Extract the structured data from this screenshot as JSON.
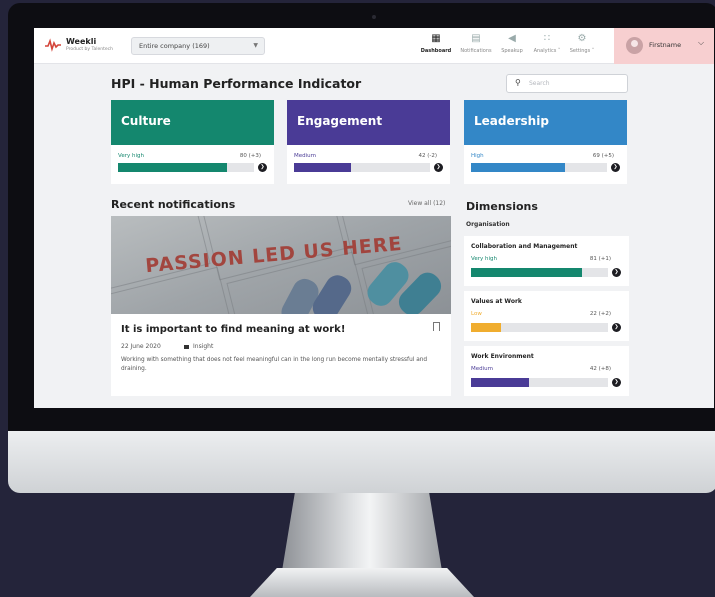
{
  "app": {
    "brand": "Weekli",
    "brand_sub": "Product by Talentech",
    "company_selector": "Entire company (169)"
  },
  "nav": [
    {
      "label": "Dashboard",
      "icon": "grid-icon"
    },
    {
      "label": "Notifications",
      "icon": "message-icon"
    },
    {
      "label": "Speakup",
      "icon": "megaphone-icon"
    },
    {
      "label": "Analytics ˅",
      "icon": "analytics-icon"
    },
    {
      "label": "Settings ˅",
      "icon": "gear-icon"
    }
  ],
  "user": {
    "name": "Firstname"
  },
  "search": {
    "placeholder": "Search"
  },
  "hpi": {
    "title": "HPI - Human Performance Indicator",
    "cards": [
      {
        "title": "Culture",
        "level": "Very high",
        "score": "80 (+3)",
        "value": 80,
        "color": "#14876e"
      },
      {
        "title": "Engagement",
        "level": "Medium",
        "score": "42 (-2)",
        "value": 42,
        "color": "#4a3b96"
      },
      {
        "title": "Leadership",
        "level": "High",
        "score": "69 (+5)",
        "value": 69,
        "color": "#3387c7"
      }
    ]
  },
  "notifications": {
    "title": "Recent notifications",
    "view_all": "View all (12)",
    "image_text": "PASSION LED US HERE",
    "item": {
      "title": "It is important to find meaning at work!",
      "date": "22 June 2020",
      "tag": "Insight",
      "text": "Working with something that does not feel meaningful can in the long run become mentally stressful and draining."
    }
  },
  "dimensions": {
    "title": "Dimensions",
    "group": "Organisation",
    "items": [
      {
        "title": "Collaboration and Management",
        "level": "Very high",
        "score": "81 (+1)",
        "value": 81,
        "color": "#14876e"
      },
      {
        "title": "Values at Work",
        "level": "Low",
        "score": "22 (+2)",
        "value": 22,
        "color": "#f0ad2f"
      },
      {
        "title": "Work Environment",
        "level": "Medium",
        "score": "42 (+8)",
        "value": 42,
        "color": "#4a3b96"
      }
    ]
  }
}
